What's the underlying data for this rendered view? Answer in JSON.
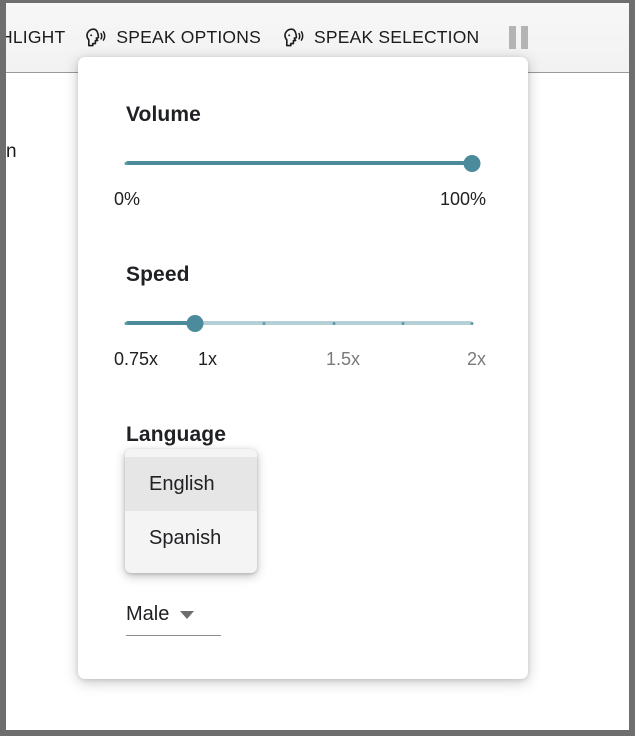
{
  "toolbar": {
    "highlight_partial_label": "HLIGHT",
    "speak_options_label": "SPEAK OPTIONS",
    "speak_selection_label": "SPEAK SELECTION",
    "speak_icon": "speak-head-icon",
    "pause_icon": "pause-icon",
    "stop_icon": "stop-icon"
  },
  "page": {
    "text_fragment": "n"
  },
  "panel": {
    "volume": {
      "title": "Volume",
      "value": 100,
      "min_label": "0%",
      "max_label": "100%",
      "track_color": "#b3d0d5",
      "fill_color": "#4b8b9c"
    },
    "speed": {
      "title": "Speed",
      "value": "1x",
      "ticks": [
        {
          "label": "0.75x",
          "pos": 0,
          "dim": false
        },
        {
          "label": "1x",
          "pos": 20,
          "dim": false
        },
        {
          "label": "1.5x",
          "pos": 60,
          "dim": true
        },
        {
          "label": "2x",
          "pos": 100,
          "dim": true
        }
      ],
      "tick_positions": [
        0,
        20,
        40,
        60,
        80,
        100
      ]
    },
    "language": {
      "title": "Language",
      "selected": "English",
      "options": [
        {
          "label": "English",
          "selected": true
        },
        {
          "label": "Spanish",
          "selected": false
        }
      ]
    },
    "voice": {
      "selected": "Male",
      "chevron_icon": "chevron-down-icon"
    }
  },
  "colors": {
    "accent": "#4b8b9c",
    "track_light": "#b3d0d5",
    "toolbar_bg": "#f4f4f4",
    "menu_highlight": "#e6e6e6"
  }
}
